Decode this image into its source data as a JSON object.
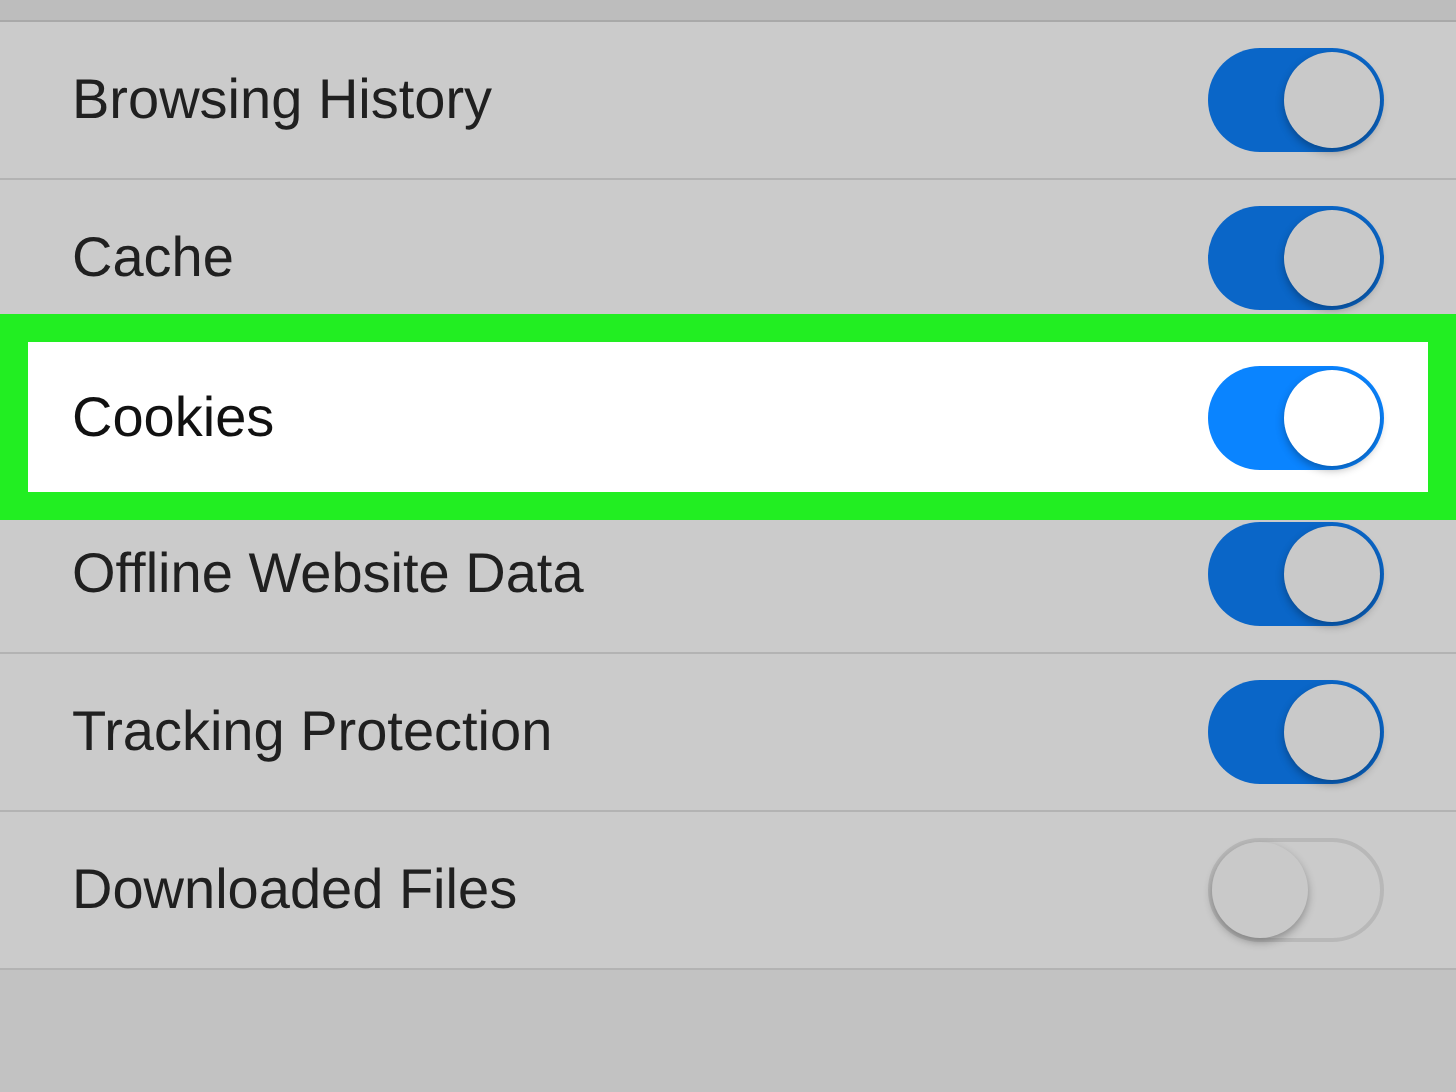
{
  "settings": [
    {
      "label": "Browsing History",
      "on": true,
      "highlighted": false
    },
    {
      "label": "Cache",
      "on": true,
      "highlighted": false
    },
    {
      "label": "Cookies",
      "on": true,
      "highlighted": true
    },
    {
      "label": "Offline Website Data",
      "on": true,
      "highlighted": false
    },
    {
      "label": "Tracking Protection",
      "on": true,
      "highlighted": false
    },
    {
      "label": "Downloaded Files",
      "on": false,
      "highlighted": false
    }
  ]
}
